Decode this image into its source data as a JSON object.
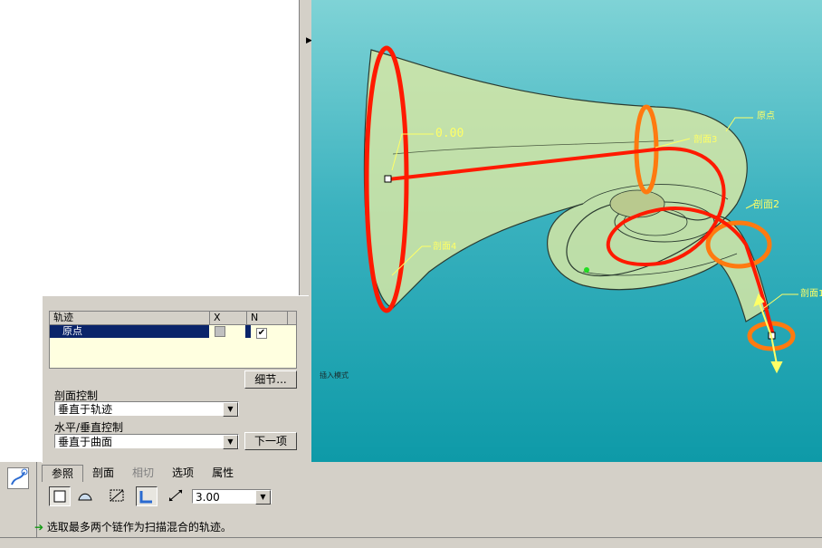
{
  "viewport": {
    "labels": {
      "value_label": "0.00",
      "section1": "剖面1",
      "section2": "剖面2",
      "section3": "剖面3",
      "section4": "剖面4",
      "origin": "原点",
      "mode_text": "插入模式"
    }
  },
  "trajectory_table": {
    "headers": [
      "轨迹",
      "X",
      "N"
    ],
    "rows": [
      {
        "name": "原点",
        "x_checked": false,
        "n_checked": true
      }
    ]
  },
  "details_button": "细节...",
  "section_control": {
    "label": "剖面控制",
    "value": "垂直于轨迹"
  },
  "hv_control": {
    "label": "水平/垂直控制",
    "value": "垂直于曲面"
  },
  "next_button": "下一项",
  "tabs": [
    {
      "label": "参照",
      "state": "active"
    },
    {
      "label": "剖面",
      "state": "normal"
    },
    {
      "label": "相切",
      "state": "disabled"
    },
    {
      "label": "选项",
      "state": "normal"
    },
    {
      "label": "属性",
      "state": "normal"
    }
  ],
  "toolbar": {
    "thickness_value": "3.00"
  },
  "status": {
    "message": "选取最多两个链作为扫描混合的轨迹。"
  },
  "colors": {
    "viewport_top": "#7fd3d6",
    "viewport_bottom": "#0e9aa8",
    "trajectory": "#ff1a00",
    "section": "#ff7a10",
    "label": "#ffff66",
    "selection": "#0a246a"
  },
  "icons": [
    "sweep-blend-feature-icon",
    "solid-icon",
    "surface-icon",
    "remove-material-icon",
    "thicken-icon",
    "flip-direction-icon",
    "arrow-green-icon"
  ]
}
